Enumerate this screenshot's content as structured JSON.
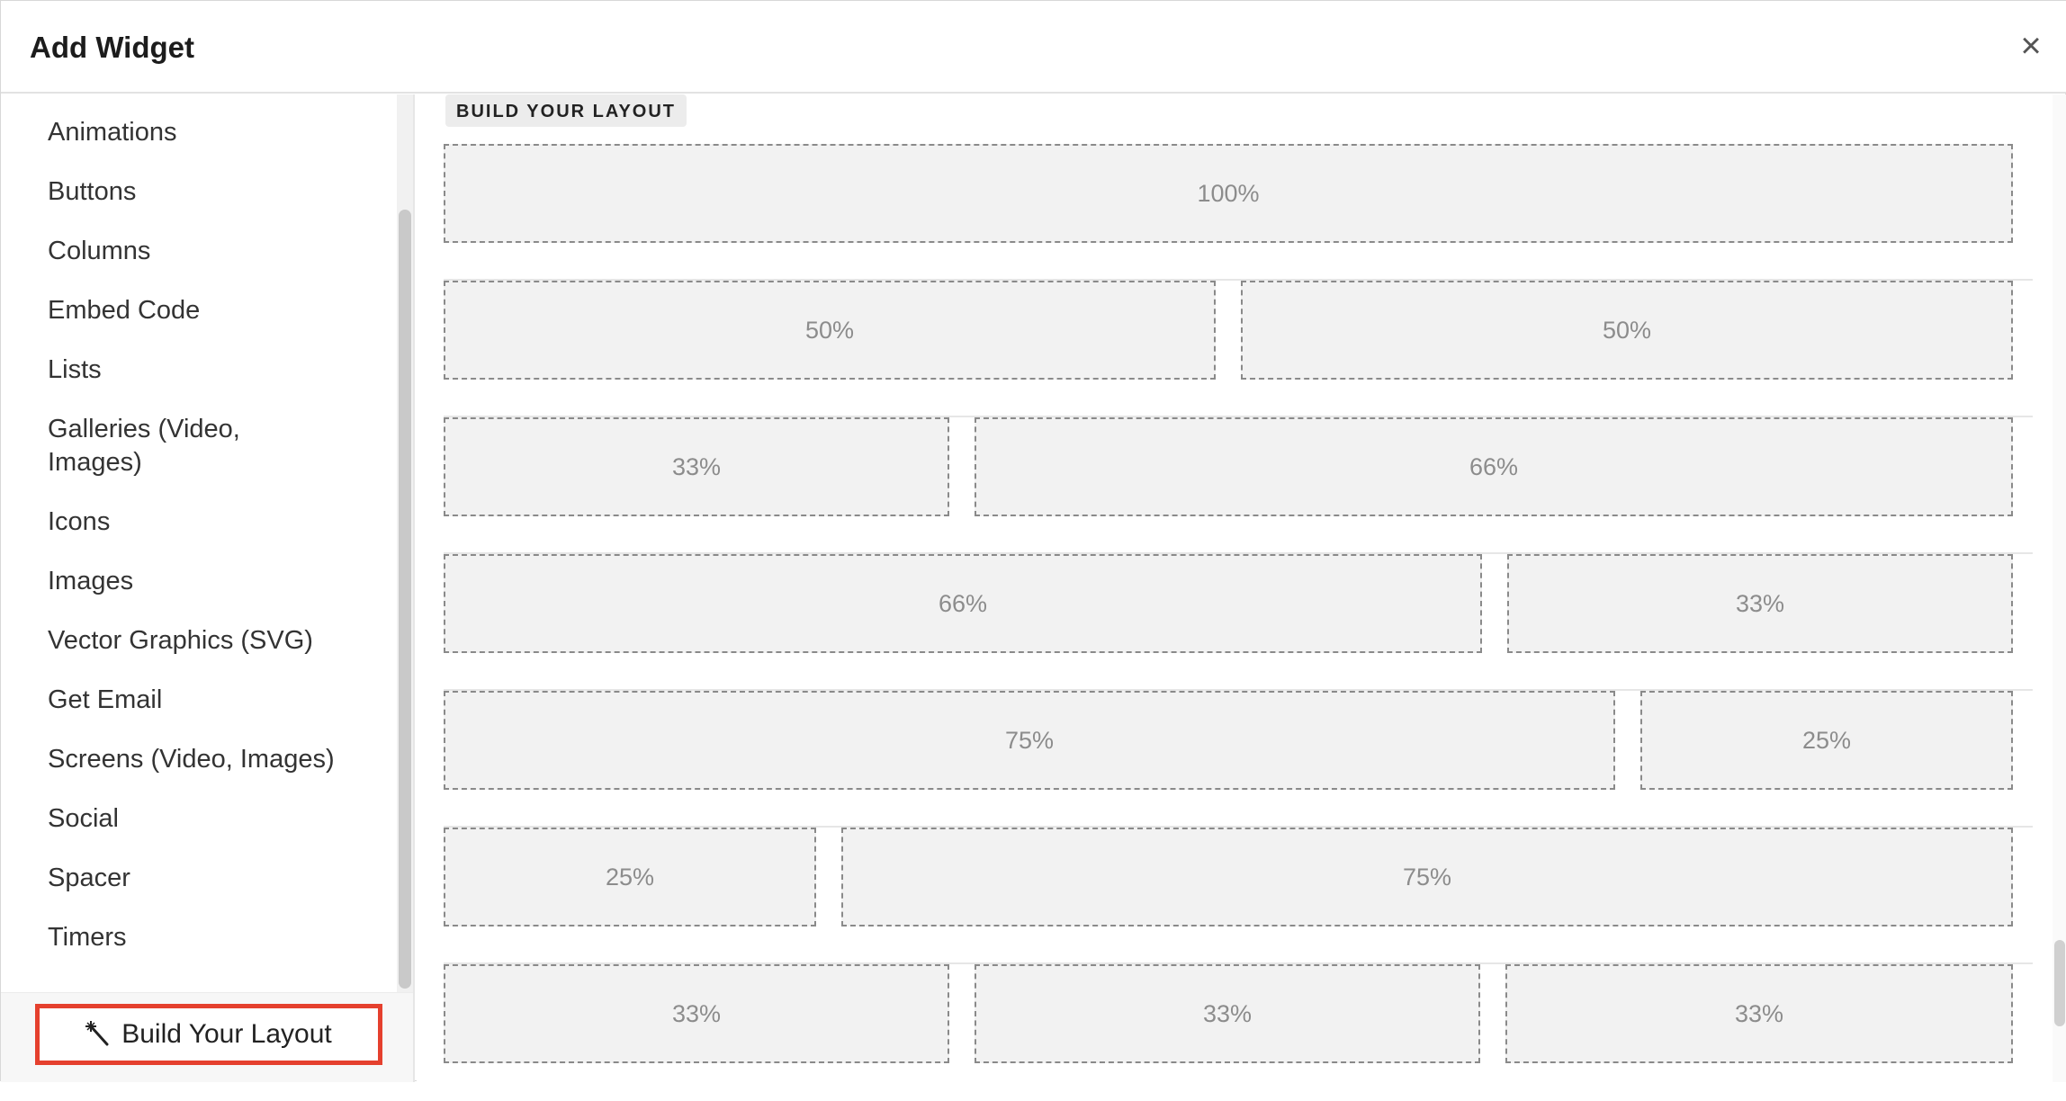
{
  "dialog": {
    "title": "Add Widget",
    "close_label": "×"
  },
  "sidebar": {
    "items": [
      {
        "label": "Animations"
      },
      {
        "label": "Buttons"
      },
      {
        "label": "Columns"
      },
      {
        "label": "Embed Code"
      },
      {
        "label": "Lists"
      },
      {
        "label": "Galleries (Video, Images)"
      },
      {
        "label": "Icons"
      },
      {
        "label": "Images"
      },
      {
        "label": "Vector Graphics (SVG)"
      },
      {
        "label": "Get Email"
      },
      {
        "label": "Screens (Video, Images)"
      },
      {
        "label": "Social"
      },
      {
        "label": "Spacer"
      },
      {
        "label": "Timers"
      }
    ],
    "build_button": {
      "label": "Build Your Layout",
      "icon": "magic-wand-icon",
      "highlight_color": "#e5402e"
    }
  },
  "content": {
    "section_label": "BUILD YOUR LAYOUT",
    "layouts": [
      {
        "name": "layout-100",
        "cells": [
          "100%"
        ]
      },
      {
        "name": "layout-50-50",
        "cells": [
          "50%",
          "50%"
        ]
      },
      {
        "name": "layout-33-66",
        "cells": [
          "33%",
          "66%"
        ]
      },
      {
        "name": "layout-66-33",
        "cells": [
          "66%",
          "33%"
        ]
      },
      {
        "name": "layout-75-25",
        "cells": [
          "75%",
          "25%"
        ]
      },
      {
        "name": "layout-25-75",
        "cells": [
          "25%",
          "75%"
        ]
      },
      {
        "name": "layout-33-33-33",
        "cells": [
          "33%",
          "33%",
          "33%"
        ]
      }
    ]
  }
}
